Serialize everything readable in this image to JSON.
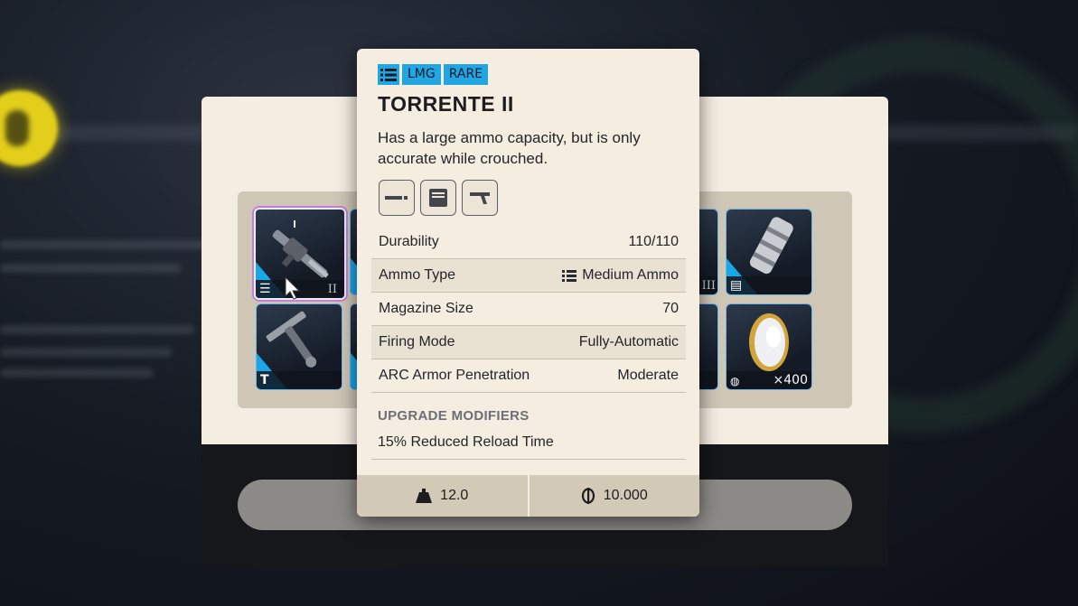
{
  "item": {
    "badges": [
      "LMG",
      "RARE"
    ],
    "category_icon": "list-icon",
    "name": "TORRENTE II",
    "description": "Has a large ammo capacity, but is only accurate while crouched.",
    "mod_slots": [
      "barrel-mod-icon",
      "magazine-mod-icon",
      "stock-mod-icon"
    ],
    "stats": [
      {
        "label": "Durability",
        "value": "110/110"
      },
      {
        "label": "Ammo Type",
        "value": "Medium Ammo",
        "icon": "medium-ammo-icon"
      },
      {
        "label": "Magazine Size",
        "value": "70"
      },
      {
        "label": "Firing Mode",
        "value": "Fully-Automatic"
      },
      {
        "label": "ARC Armor Penetration",
        "value": "Moderate"
      }
    ],
    "upgrade_heading": "UPGRADE MODIFIERS",
    "upgrade_text": "15% Reduced Reload Time",
    "weight": "12.0",
    "price": "10.000"
  },
  "inventory": {
    "slots": [
      {
        "name": "torrente-slot",
        "tier": "II",
        "icon": "list-icon",
        "selected": true
      },
      {
        "name": "slot-2",
        "icon": "list-icon"
      },
      {
        "name": "slot-3",
        "tier": "III"
      },
      {
        "name": "gauntlet-slot",
        "icon": "document-icon"
      },
      {
        "name": "tool-slot",
        "icon": "t-icon"
      },
      {
        "name": "slot-6"
      },
      {
        "name": "slot-7"
      },
      {
        "name": "coin-slot",
        "quantity": "×400",
        "icon": "rock-icon"
      }
    ],
    "accent_color": "#19a7e8",
    "rarity_color": "#22a6e2"
  }
}
